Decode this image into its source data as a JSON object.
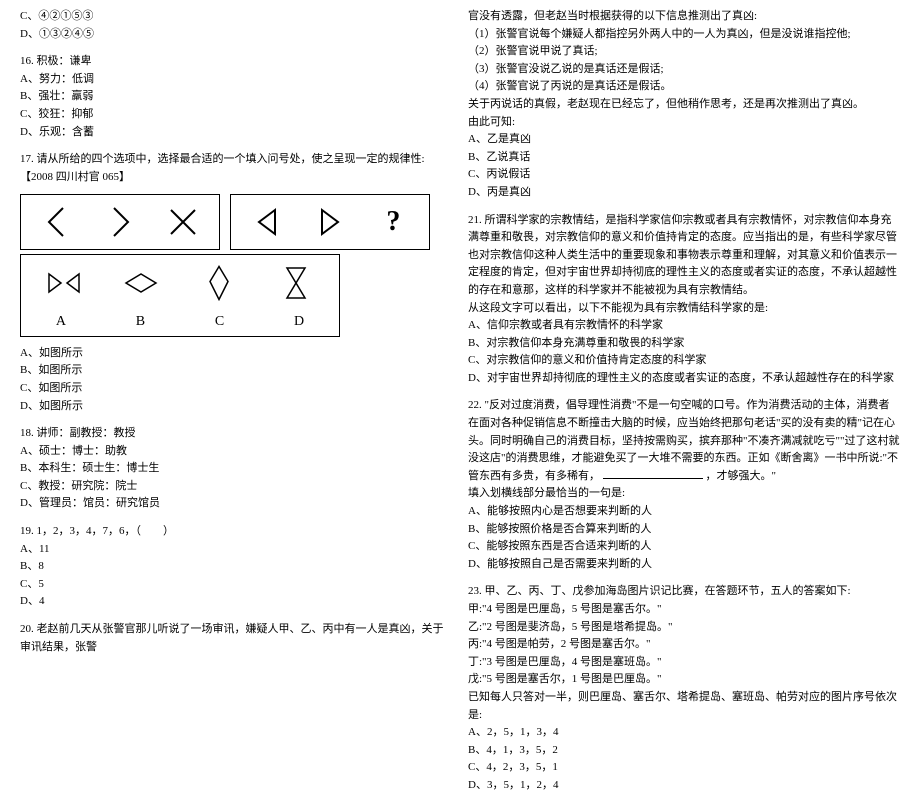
{
  "left": {
    "q15_opts": {
      "c": "C、④②①⑤③",
      "d": "D、①③②④⑤"
    },
    "q16": {
      "stem": "16. 积极：谦卑",
      "a": "A、努力：低调",
      "b": "B、强壮：羸弱",
      "c": "C、狡狂：抑郁",
      "d": "D、乐观：含蓄"
    },
    "q17": {
      "stem": "17. 请从所给的四个选项中，选择最合适的一个填入问号处，使之呈现一定的规律性:【2008 四川村官 065】",
      "labels": {
        "a": "A",
        "b": "B",
        "c": "C",
        "d": "D"
      },
      "a": "A、如图所示",
      "b": "B、如图所示",
      "c": "C、如图所示",
      "d": "D、如图所示"
    },
    "q18": {
      "stem": "18. 讲师：副教授：教授",
      "a": "A、硕士：博士：助教",
      "b": "B、本科生：硕士生：博士生",
      "c": "C、教授：研究院：院士",
      "d": "D、管理员：馆员：研究馆员"
    },
    "q19": {
      "stem": "19. 1，2，3，4，7，6，（　　）",
      "a": "A、11",
      "b": "B、8",
      "c": "C、5",
      "d": "D、4"
    },
    "q20": {
      "stem": "20. 老赵前几天从张警官那儿听说了一场审讯，嫌疑人甲、乙、丙中有一人是真凶，关于审讯结果，张警"
    }
  },
  "right": {
    "q20_cont": {
      "l1": "官没有透露，但老赵当时根据获得的以下信息推测出了真凶:",
      "l2": "（1）张警官说每个嫌疑人都指控另外两人中的一人为真凶，但是没说谁指控他;",
      "l3": "（2）张警官说甲说了真话;",
      "l4": "（3）张警官没说乙说的是真话还是假话;",
      "l5": "（4）张警官说了丙说的是真话还是假话。",
      "l6": "关于丙说话的真假，老赵现在已经忘了，但他稍作思考，还是再次推测出了真凶。",
      "l7": "由此可知:",
      "a": "A、乙是真凶",
      "b": "B、乙说真话",
      "c": "C、丙说假话",
      "d": "D、丙是真凶"
    },
    "q21": {
      "stem": "21. 所谓科学家的宗教情结，是指科学家信仰宗教或者具有宗教情怀，对宗教信仰本身充满尊重和敬畏，对宗教信仰的意义和价值持肯定的态度。应当指出的是，有些科学家尽管也对宗教信仰这种人类生活中的重要现象和事物表示尊重和理解，对其意义和价值表示一定程度的肯定，但对宇宙世界却持彻底的理性主义的态度或者实证的态度，不承认超越性的存在和意那，这样的科学家并不能被视为具有宗教情结。",
      "l2": "从这段文字可以看出，以下不能视为具有宗教情结科学家的是:",
      "a": "A、信仰宗教或者具有宗教情怀的科学家",
      "b": "B、对宗教信仰本身充满尊重和敬畏的科学家",
      "c": "C、对宗教信仰的意义和价值持肯定态度的科学家",
      "d": "D、对宇宙世界却持彻底的理性主义的态度或者实证的态度，不承认超越性存在的科学家"
    },
    "q22": {
      "stem": "22. \"反对过度消费，倡导理性消费\"不是一句空喊的口号。作为消费活动的主体，消费者在面对各种促销信息不断撞击大脑的时候，应当始终把那句老话\"买的没有卖的精\"记在心头。同时明确自己的消费目标，坚持按需购买，摈弃那种\"不凑齐满减就吃亏\"\"过了这村就没这店\"的消费思维，才能避免买了一大堆不需要的东西。正如《断舍离》一书中所说:\"不管东西有多贵，有多稀有，",
      "blank_suffix": "，才够强大。\"",
      "l2": "填入划横线部分最恰当的一句是:",
      "a": "A、能够按照内心是否想要来判断的人",
      "b": "B、能够按照价格是否合算来判断的人",
      "c": "C、能够按照东西是否合适来判断的人",
      "d": "D、能够按照自己是否需要来判断的人"
    },
    "q23": {
      "stem": "23. 甲、乙、丙、丁、戊参加海岛图片识记比赛，在答题环节，五人的答案如下:",
      "l1": "甲:\"4 号图是巴厘岛，5 号图是塞舌尔。\"",
      "l2": "乙:\"2 号图是斐济岛，5 号图是塔希提岛。\"",
      "l3": "丙:\"4 号图是帕劳，2 号图是塞舌尔。\"",
      "l4": "丁:\"3 号图是巴厘岛，4 号图是塞班岛。\"",
      "l5": "戊:\"5 号图是塞舌尔，1 号图是巴厘岛。\"",
      "l6": "已知每人只答对一半，则巴厘岛、塞舌尔、塔希提岛、塞班岛、帕劳对应的图片序号依次是:",
      "a": "A、2，5，1，3，4",
      "b": "B、4，1，3，5，2",
      "c": "C、4，2，3，5，1",
      "d": "D、3，5，1，2，4"
    }
  }
}
